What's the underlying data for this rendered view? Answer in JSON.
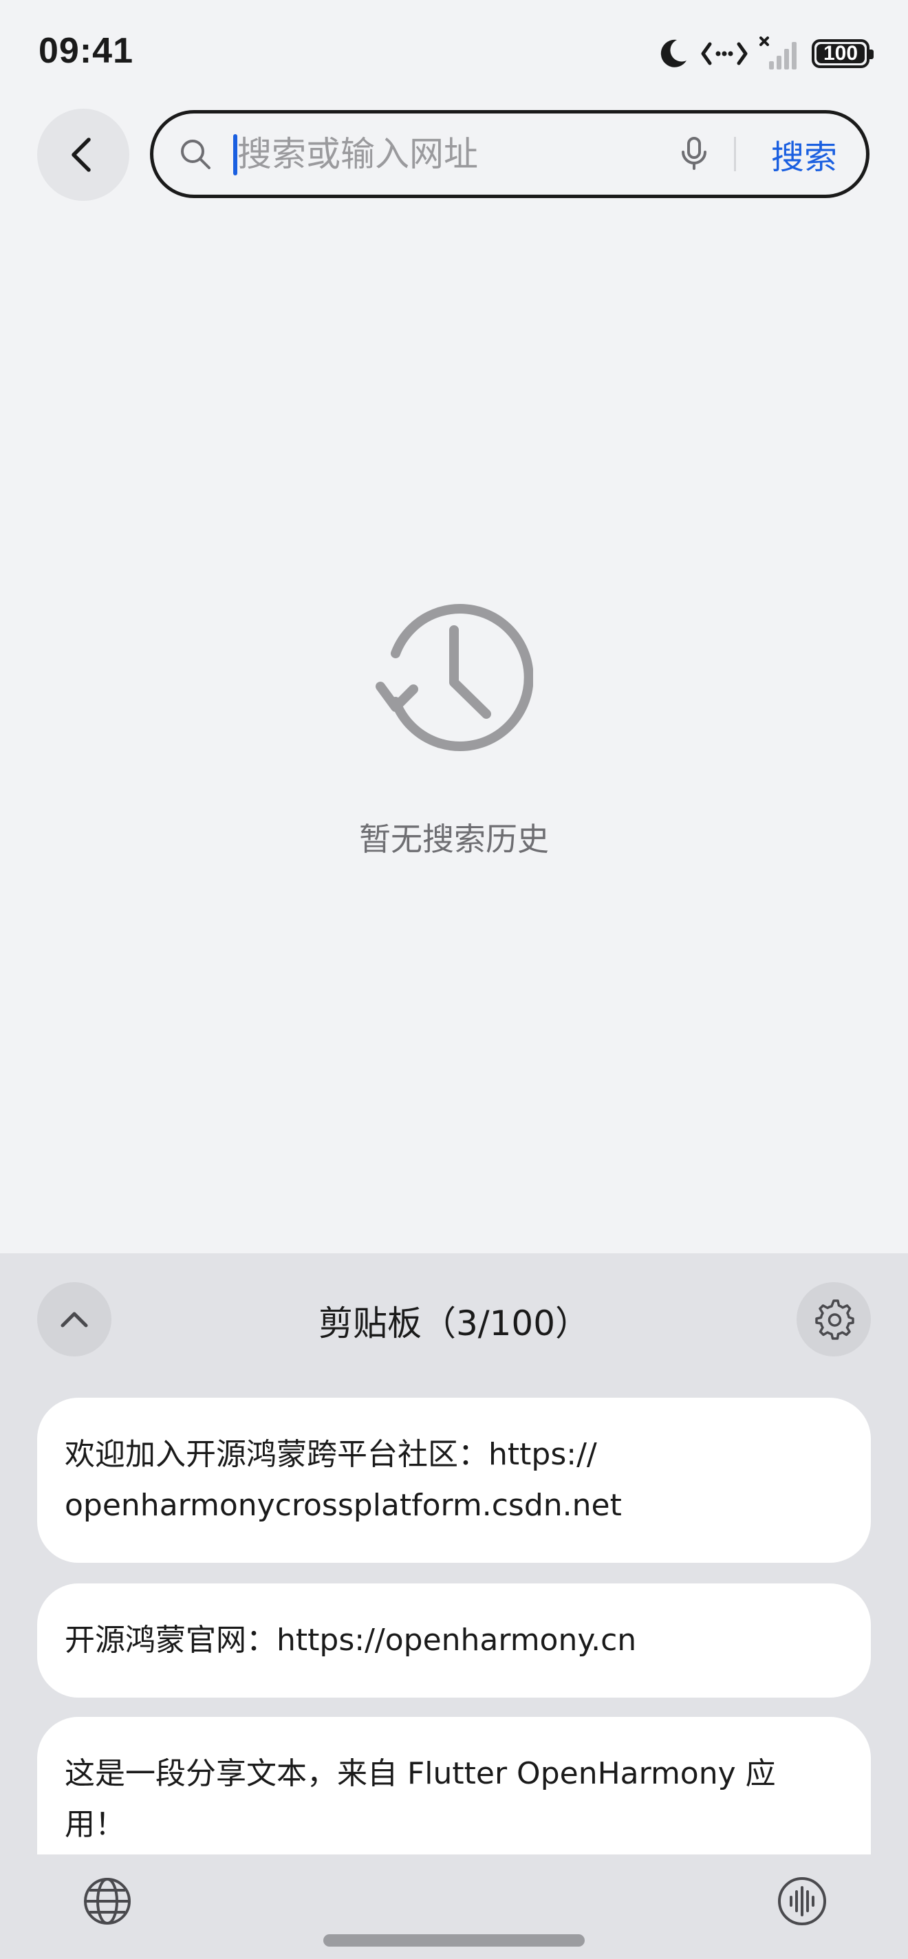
{
  "status_bar": {
    "time": "09:41",
    "battery": "100",
    "battery_level": 1.0
  },
  "search": {
    "placeholder": "搜索或输入网址",
    "value": "",
    "search_label": "搜索"
  },
  "empty_state": {
    "message": "暂无搜索历史"
  },
  "clipboard": {
    "title": "剪贴板（3/100）",
    "items": [
      {
        "text_line1": "欢迎加入开源鸿蒙跨平台社区：https://",
        "text_line2": "openharmonycrossplatform.csdn.net"
      },
      {
        "text_line1": "开源鸿蒙官网：https://openharmony.cn"
      },
      {
        "text_line1": "这是一段分享文本，来自 Flutter OpenHarmony 应",
        "text_line2": "用！"
      }
    ]
  },
  "colors": {
    "accent": "#1a5fe0",
    "background": "#f2f3f5",
    "panel": "#e1e2e6"
  }
}
